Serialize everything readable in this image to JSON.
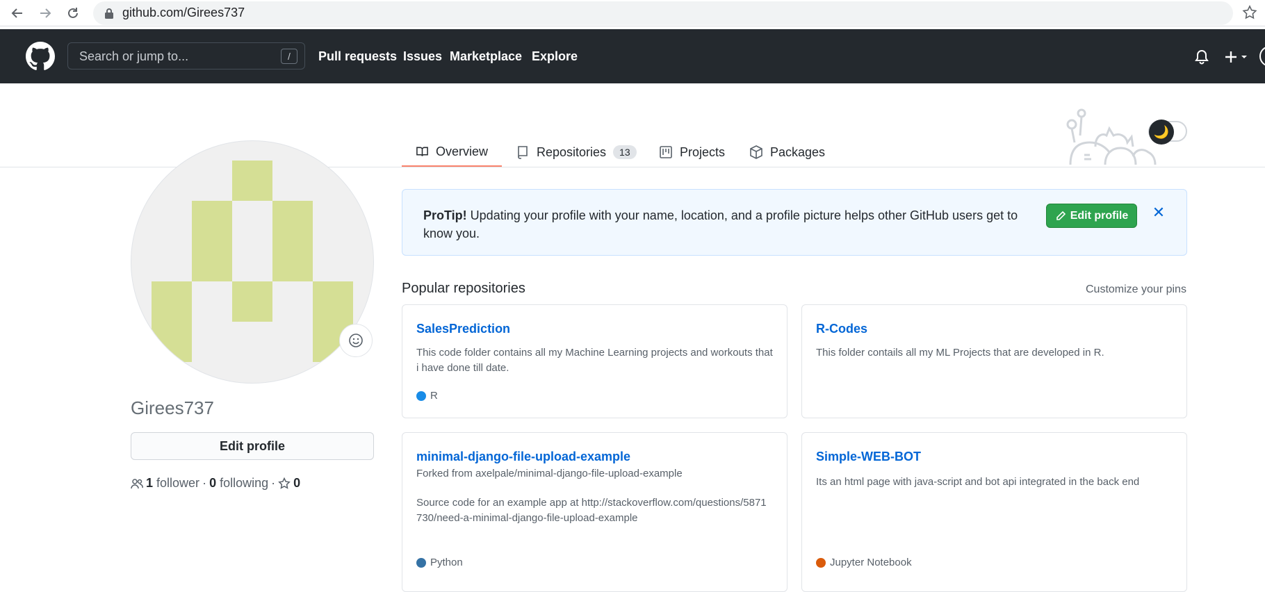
{
  "browser": {
    "url": "github.com/Girees737"
  },
  "header": {
    "search_placeholder": "Search or jump to...",
    "slash_key": "/",
    "nav": [
      "Pull requests",
      "Issues",
      "Marketplace",
      "Explore"
    ]
  },
  "tabs": [
    {
      "label": "Overview"
    },
    {
      "label": "Repositories",
      "count": "13"
    },
    {
      "label": "Projects"
    },
    {
      "label": "Packages"
    }
  ],
  "profile": {
    "username": "Girees737",
    "edit_label": "Edit profile",
    "followers_count": "1",
    "followers_label": "follower",
    "following_count": "0",
    "following_label": "following",
    "stars_count": "0",
    "separator": "·"
  },
  "protip": {
    "lead": "ProTip!",
    "text": " Updating your profile with your name, location, and a profile picture helps other GitHub users get to know you.",
    "button_label": "Edit profile",
    "close_symbol": "✕"
  },
  "popular": {
    "heading": "Popular repositories",
    "customize_label": "Customize your pins",
    "repos": [
      {
        "name": "SalesPrediction",
        "description": "This code folder contains all my Machine Learning projects and workouts that i have done till date.",
        "language": "R",
        "language_color": "#198ce7"
      },
      {
        "name": "R-Codes",
        "description": "This folder contails all my ML Projects that are developed in R.",
        "language": "",
        "language_color": ""
      },
      {
        "name": "minimal-django-file-upload-example",
        "fork_note": "Forked from axelpale/minimal-django-file-upload-example",
        "description": "Source code for an example app at http://stackoverflow.com/questions/5871730/need-a-minimal-django-file-upload-example",
        "language": "Python",
        "language_color": "#3572A5"
      },
      {
        "name": "Simple-WEB-BOT",
        "description": "Its an html page with java-script and bot api integrated in the back end",
        "language": "Jupyter Notebook",
        "language_color": "#DA5B0B"
      }
    ]
  },
  "theme_toggle": {
    "icon": "moon-icon",
    "glyph": "🌙"
  },
  "colors": {
    "header_bg": "#24292e",
    "link": "#0366d6",
    "green_button": "#2ea44f",
    "tab_underline": "#f9826c",
    "identicon": "#d5df95"
  }
}
